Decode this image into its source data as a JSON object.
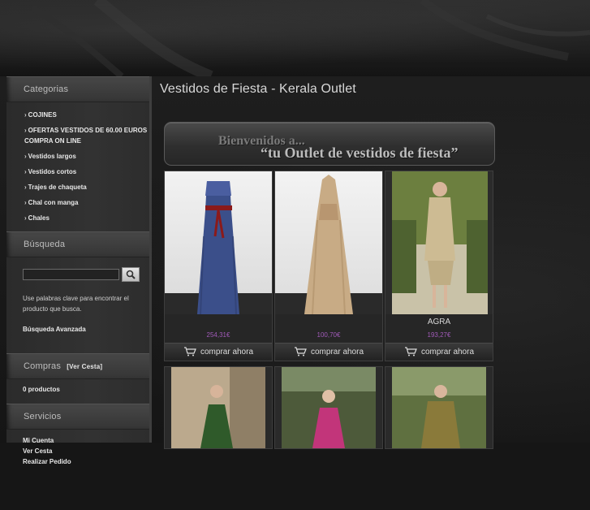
{
  "sidebar": {
    "categories_title": "Categorias",
    "categories": [
      {
        "label": "COJINES"
      },
      {
        "label": "OFERTAS VESTIDOS DE 60.00 EUROS COMPRA ON LINE"
      },
      {
        "label": "Vestidos largos"
      },
      {
        "label": "Vestidos cortos"
      },
      {
        "label": "Trajes de chaqueta"
      },
      {
        "label": "Chal con manga"
      },
      {
        "label": "Chales"
      }
    ],
    "search_title": "Búsqueda",
    "search_help": "Use palabras clave para encontrar el producto que busca.",
    "advanced_search": "Búsqueda Avanzada",
    "cart_title": "Compras",
    "cart_link": "[Ver Cesta]",
    "cart_count": "0 productos",
    "services_title": "Servicios",
    "services": [
      {
        "label": "Mi Cuenta"
      },
      {
        "label": "Ver Cesta"
      },
      {
        "label": "Realizar Pedido"
      }
    ]
  },
  "main": {
    "title": "Vestidos de Fiesta - Kerala Outlet",
    "banner_line1": "Bienvenidos a...",
    "banner_line2": "“tu Outlet de vestidos de fiesta”",
    "products": [
      {
        "name": "",
        "price": "254,31€",
        "buy": "comprar ahora"
      },
      {
        "name": "",
        "price": "100,70€",
        "buy": "comprar ahora"
      },
      {
        "name": "AGRA",
        "price": "193,27€",
        "buy": "comprar ahora"
      }
    ]
  },
  "icons": [
    "search-icon",
    "cart-icon",
    "arrow-icon"
  ]
}
